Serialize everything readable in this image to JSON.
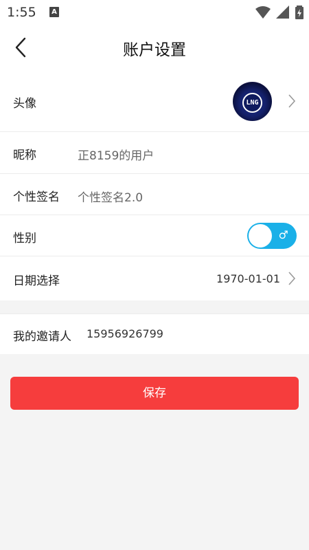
{
  "status_bar": {
    "time": "1:55",
    "notification_badge": "A"
  },
  "header": {
    "title": "账户设置",
    "back_icon": "chevron-left-icon"
  },
  "rows": {
    "avatar": {
      "label": "头像"
    },
    "nickname": {
      "label": "昵称",
      "value": "正8159的用户"
    },
    "signature": {
      "label": "个性签名",
      "value": "个性签名2.0"
    },
    "gender": {
      "label": "性别",
      "symbol": "♂",
      "is_male": true
    },
    "date": {
      "label": "日期选择",
      "value": "1970-01-01"
    },
    "inviter": {
      "label": "我的邀请人",
      "value": "15956926799"
    }
  },
  "save_button": {
    "label": "保存"
  },
  "colors": {
    "save_button": "#f63d3d",
    "toggle_on": "#1ab0e8",
    "page_background": "#f4f4f4"
  }
}
